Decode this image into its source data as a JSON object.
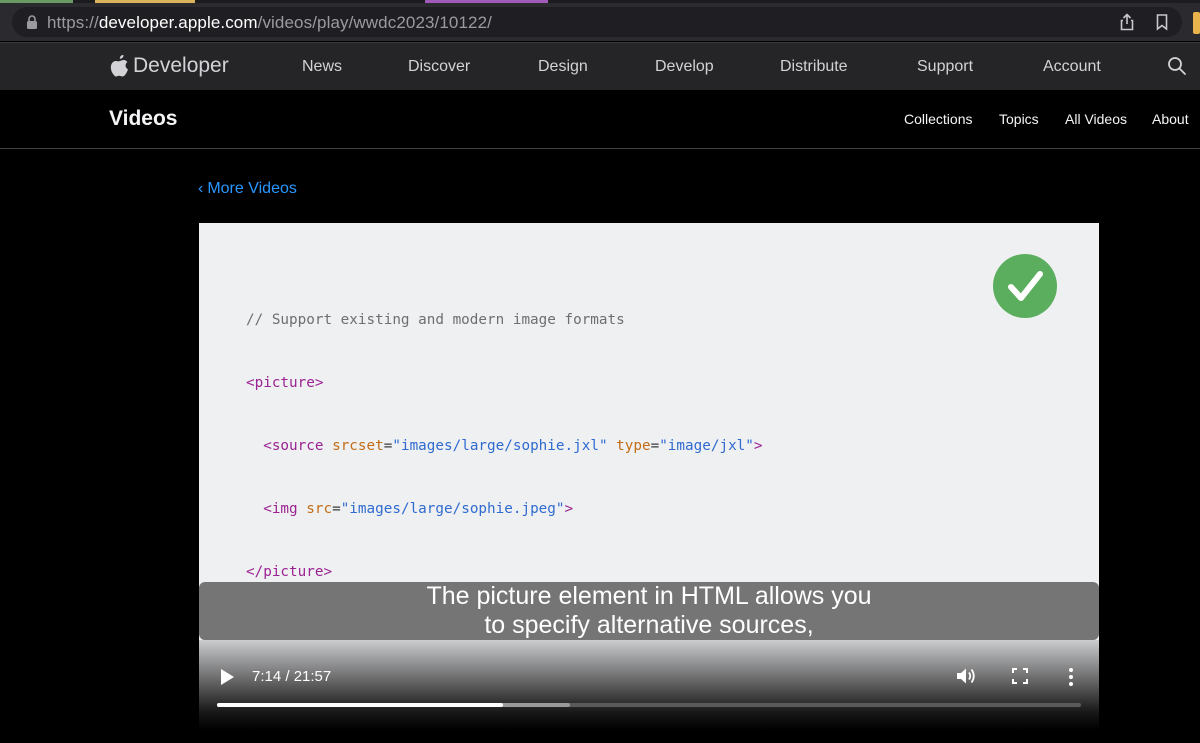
{
  "browser": {
    "url_scheme": "https://",
    "url_host": "developer.apple.com",
    "url_path": "/videos/play/wwdc2023/10122/"
  },
  "globalnav": {
    "brand": "Developer",
    "items": [
      "News",
      "Discover",
      "Design",
      "Develop",
      "Distribute",
      "Support",
      "Account"
    ]
  },
  "localnav": {
    "title": "Videos",
    "items": [
      "Collections",
      "Topics",
      "All Videos",
      "About"
    ]
  },
  "back_link": {
    "chevron": "‹",
    "label": "More Videos"
  },
  "video": {
    "code": {
      "comment": "// Support existing and modern image formats",
      "line2_tag": "<picture>",
      "line3_open": "<source",
      "line3_attr1": "srcset",
      "line3_val1": "\"images/large/sophie.jxl\"",
      "line3_attr2": "type",
      "line3_val2": "\"image/jxl\"",
      "line3_close": ">",
      "line4_open": "<img",
      "line4_attr": "src",
      "line4_val": "\"images/large/sophie.jpeg\"",
      "line4_close": ">",
      "line5_tag": "</picture>",
      "eq": "="
    },
    "caption": {
      "line1": "The picture element in HTML allows you",
      "line2": "to specify alternative sources,"
    },
    "time": "7:14 / 21:57",
    "progress_played": 0.331,
    "progress_buffered": 0.409,
    "icons": [
      "play-icon",
      "volume-icon",
      "fullscreen-icon",
      "more-icon",
      "check-icon"
    ]
  },
  "colors": {
    "accent_link": "#2997ff",
    "check_green": "#5cae5f",
    "code_tag": "#9b2393",
    "code_attr": "#c36d17",
    "code_string": "#2f6bd0"
  }
}
